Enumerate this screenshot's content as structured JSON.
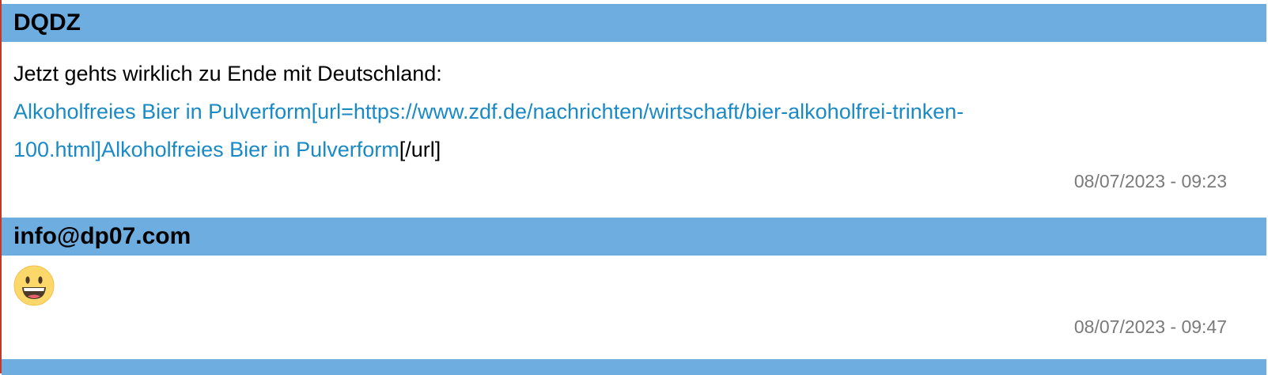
{
  "posts": [
    {
      "author": "DQDZ",
      "text_intro": "Jetzt gehts wirklich zu Ende mit Deutschland:",
      "link_line1": "Alkoholfreies Bier in Pulverform[url=https://www.zdf.de/nachrichten/wirtschaft/bier-alkoholfrei-trinken-",
      "link_line2": "100.html]Alkoholfreies Bier in Pulverform",
      "text_tail": "[/url]",
      "timestamp": "08/07/2023 - 09:23"
    },
    {
      "author": "info@dp07.com",
      "emoji": "grinning-face-emoji",
      "timestamp": "08/07/2023 - 09:47"
    }
  ],
  "colors": {
    "header_bg": "#6daddf",
    "link": "#1a8ac7",
    "timestamp": "#7a7a7a",
    "left_border": "#c0392b"
  }
}
